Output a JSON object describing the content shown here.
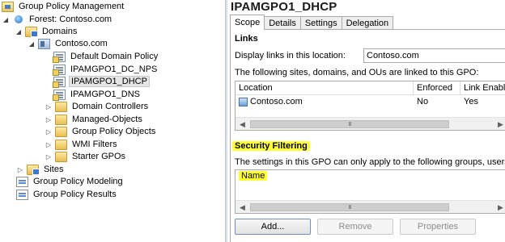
{
  "tree": {
    "root": "Group Policy Management",
    "forest": "Forest: Contoso.com",
    "domains": "Domains",
    "domain": "Contoso.com",
    "gpo_links": [
      "Default Domain Policy",
      "IPAMGPO1_DC_NPS",
      "IPAMGPO1_DHCP",
      "IPAMGPO1_DNS"
    ],
    "selected": "IPAMGPO1_DHCP",
    "containers": [
      "Domain Controllers",
      "Managed-Objects",
      "Group Policy Objects",
      "WMI Filters",
      "Starter GPOs"
    ],
    "sites": "Sites",
    "modeling": "Group Policy Modeling",
    "results": "Group Policy Results"
  },
  "detail": {
    "title": "IPAMGPO1_DHCP",
    "tabs": [
      "Scope",
      "Details",
      "Settings",
      "Delegation"
    ],
    "active_tab": "Scope",
    "links": {
      "heading": "Links",
      "display_label": "Display links in this location:",
      "display_value": "Contoso.com",
      "description": "The following sites, domains, and OUs are linked to this GPO:",
      "columns": [
        "Location",
        "Enforced",
        "Link Enabled"
      ],
      "rows": [
        {
          "location": "Contoso.com",
          "enforced": "No",
          "link_enabled": "Yes"
        }
      ]
    },
    "security": {
      "heading": "Security Filtering",
      "description": "The settings in this GPO can only apply to the following groups, users, and computers:",
      "columns": [
        "Name"
      ],
      "buttons": {
        "add": "Add...",
        "remove": "Remove",
        "properties": "Properties"
      }
    }
  },
  "colors": {
    "highlight": "#ffff33",
    "selection": "#e5e5e5"
  }
}
